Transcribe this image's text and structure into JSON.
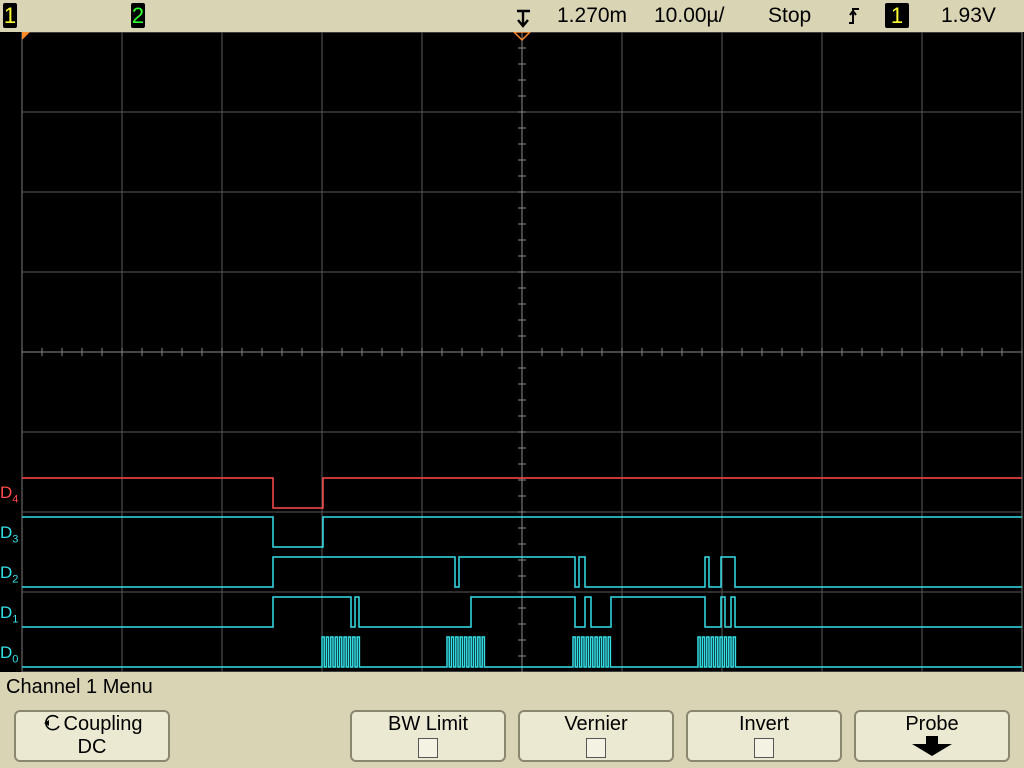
{
  "status_bar": {
    "channel1": "1",
    "channel2": "2",
    "horizontal_position": "1.270m",
    "time_per_div": "10.00µ/",
    "run_state": "Stop",
    "trigger_slope_icon": "rising-edge-icon",
    "trigger_source": "1",
    "trigger_level": "1.93V"
  },
  "digital_channels": [
    {
      "name": "D",
      "index": "4",
      "color": "#ff4a4a"
    },
    {
      "name": "D",
      "index": "3",
      "color": "#33e0e8"
    },
    {
      "name": "D",
      "index": "2",
      "color": "#33e0e8"
    },
    {
      "name": "D",
      "index": "1",
      "color": "#33e0e8"
    },
    {
      "name": "D",
      "index": "0",
      "color": "#33e0e8"
    }
  ],
  "menu": {
    "title": "Channel 1  Menu",
    "coupling_label": "Coupling",
    "coupling_value": "DC",
    "bw_limit_label": "BW Limit",
    "vernier_label": "Vernier",
    "invert_label": "Invert",
    "probe_label": "Probe"
  },
  "colors": {
    "grid": "#7a7a7a",
    "status_bg": "#d9d4b4",
    "cyan_trace": "#33e0e8",
    "red_trace": "#ff4a4a",
    "marker": "#ff8a2a"
  }
}
